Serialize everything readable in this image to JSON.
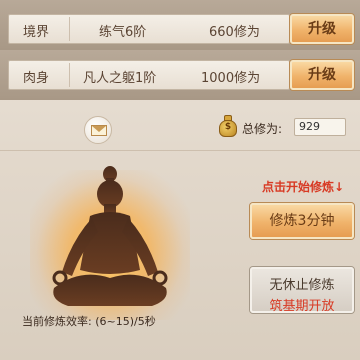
{
  "realm": {
    "label": "境界",
    "stage": "练气6阶",
    "value": "660修为",
    "upgrade_label": "升级"
  },
  "body": {
    "label": "肉身",
    "stage": "凡人之躯1阶",
    "value": "1000修为",
    "upgrade_label": "升级"
  },
  "mail": {
    "icon": "mail-icon"
  },
  "total": {
    "icon": "money-bag-icon",
    "label": "总修为:",
    "value": "929"
  },
  "figure": {
    "icon": "meditating-figure-icon"
  },
  "rate_text": "当前修炼效率: (6~15)/5秒",
  "hint": "点击开始修炼↓",
  "cultivate_button": "修炼3分钟",
  "endless_button": {
    "line1": "无休止修炼",
    "line2": "筑基期开放"
  },
  "colors": {
    "accent_orange": "#f0b36b",
    "hint_red": "#d83a24",
    "text_brown": "#5b4433"
  }
}
